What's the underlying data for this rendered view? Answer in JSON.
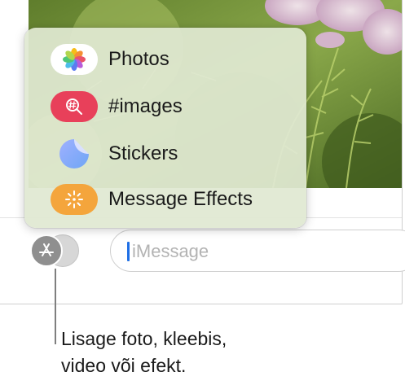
{
  "menu": {
    "items": [
      {
        "label": "Photos",
        "icon": "photos-icon"
      },
      {
        "label": "#images",
        "icon": "images-search-icon",
        "color": "#e8405a"
      },
      {
        "label": "Stickers",
        "icon": "stickers-icon",
        "color": "#8a9ff0"
      },
      {
        "label": "Message Effects",
        "icon": "message-effects-icon",
        "color": "#f4a53c"
      }
    ]
  },
  "composer": {
    "apps_button_icon": "app-store-icon",
    "placeholder": "iMessage"
  },
  "caption": {
    "line1": "Lisage foto, kleebis,",
    "line2": "video või efekt."
  }
}
